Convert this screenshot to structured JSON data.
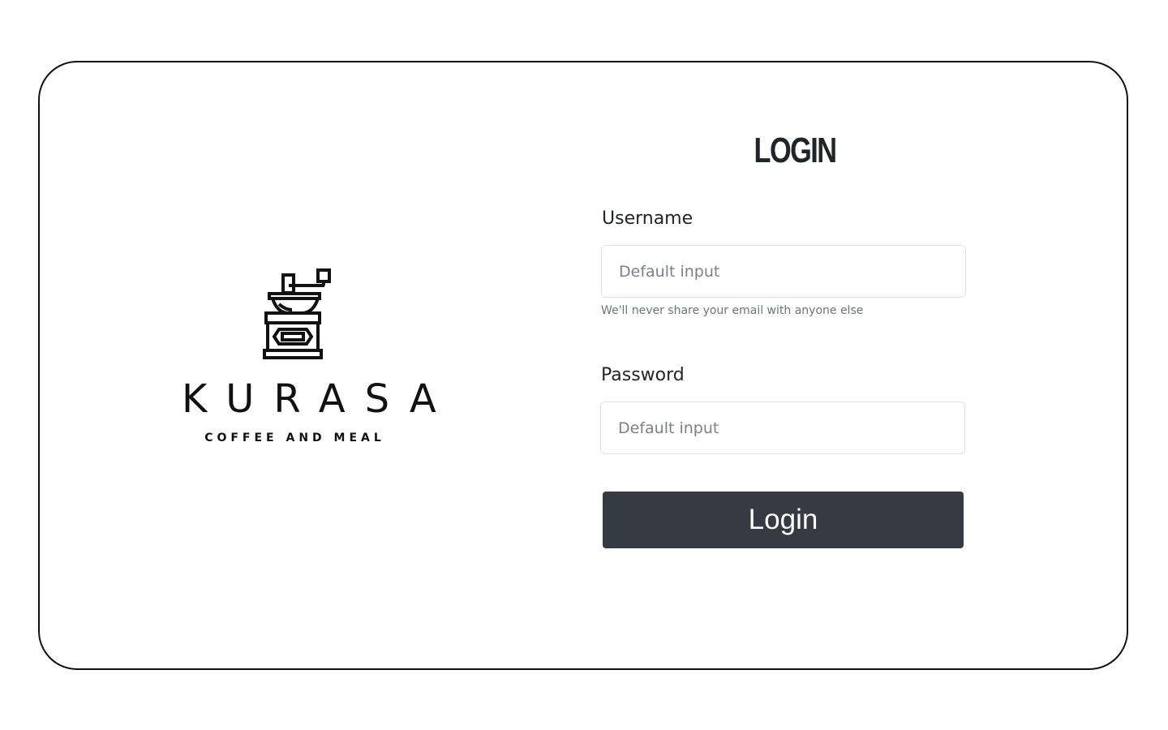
{
  "brand": {
    "name": "KURASA",
    "tagline": "COFFEE AND MEAL",
    "logo_icon": "coffee-grinder-icon"
  },
  "login": {
    "title": "LOGIN",
    "username": {
      "label": "Username",
      "placeholder": "Default input",
      "value": "",
      "help": "We'll never share your email with anyone else"
    },
    "password": {
      "label": "Password",
      "placeholder": "Default input",
      "value": ""
    },
    "submit_label": "Login"
  },
  "colors": {
    "button_bg": "#363a41",
    "card_border": "#111111",
    "input_border": "#dee2e6",
    "help_text": "#6c757d"
  }
}
